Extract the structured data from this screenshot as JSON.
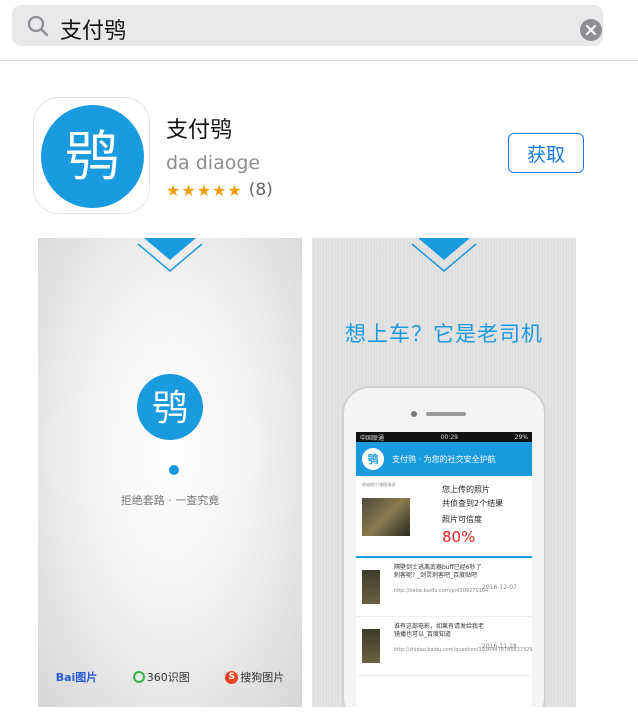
{
  "search": {
    "query": "支付鸮"
  },
  "app": {
    "name": "支付鸮",
    "developer": "da diaoge",
    "stars": "★★★★★",
    "rating_count": "(8)",
    "get_label": "获取",
    "icon_glyph": "鸮"
  },
  "screenshot1": {
    "logo_glyph": "鸮",
    "tagline": "拒绝套路 · 一查究竟",
    "brands": [
      "Bai图片",
      "360识图",
      "搜狗图片"
    ]
  },
  "screenshot2": {
    "headline": "想上车？它是老司机",
    "status_left": "中国联通",
    "status_time": "00:29",
    "status_right": "29%",
    "app_bar_title": "支付鸮 · 为您的社交安全护航",
    "mini_logo_glyph": "鸮",
    "result_caption": "原始图片/查图请求",
    "result_line1": "您上传的照片",
    "result_line2": "共侦查到2个结果",
    "result_line3": "照片可信度",
    "result_percent": "80%",
    "rows": [
      {
        "text": "隔壁剑士逃离武器buff已经6秒了刺客呢? _剑灵刺客吧_百度贴吧",
        "url": "http://tieba.baidu.com/p/4309270194",
        "date": "2016-12-07"
      },
      {
        "text": "谁有这部电影，如果有请发给我老镜播也可以_百度知道",
        "url": "http://zhidao.baidu.com/question/1926447878663732907.html",
        "date": "2016-11-28"
      }
    ]
  },
  "colors": {
    "accent": "#1a9be0",
    "button": "#1a7be8",
    "star": "#f39c12",
    "percent": "#e02424"
  }
}
